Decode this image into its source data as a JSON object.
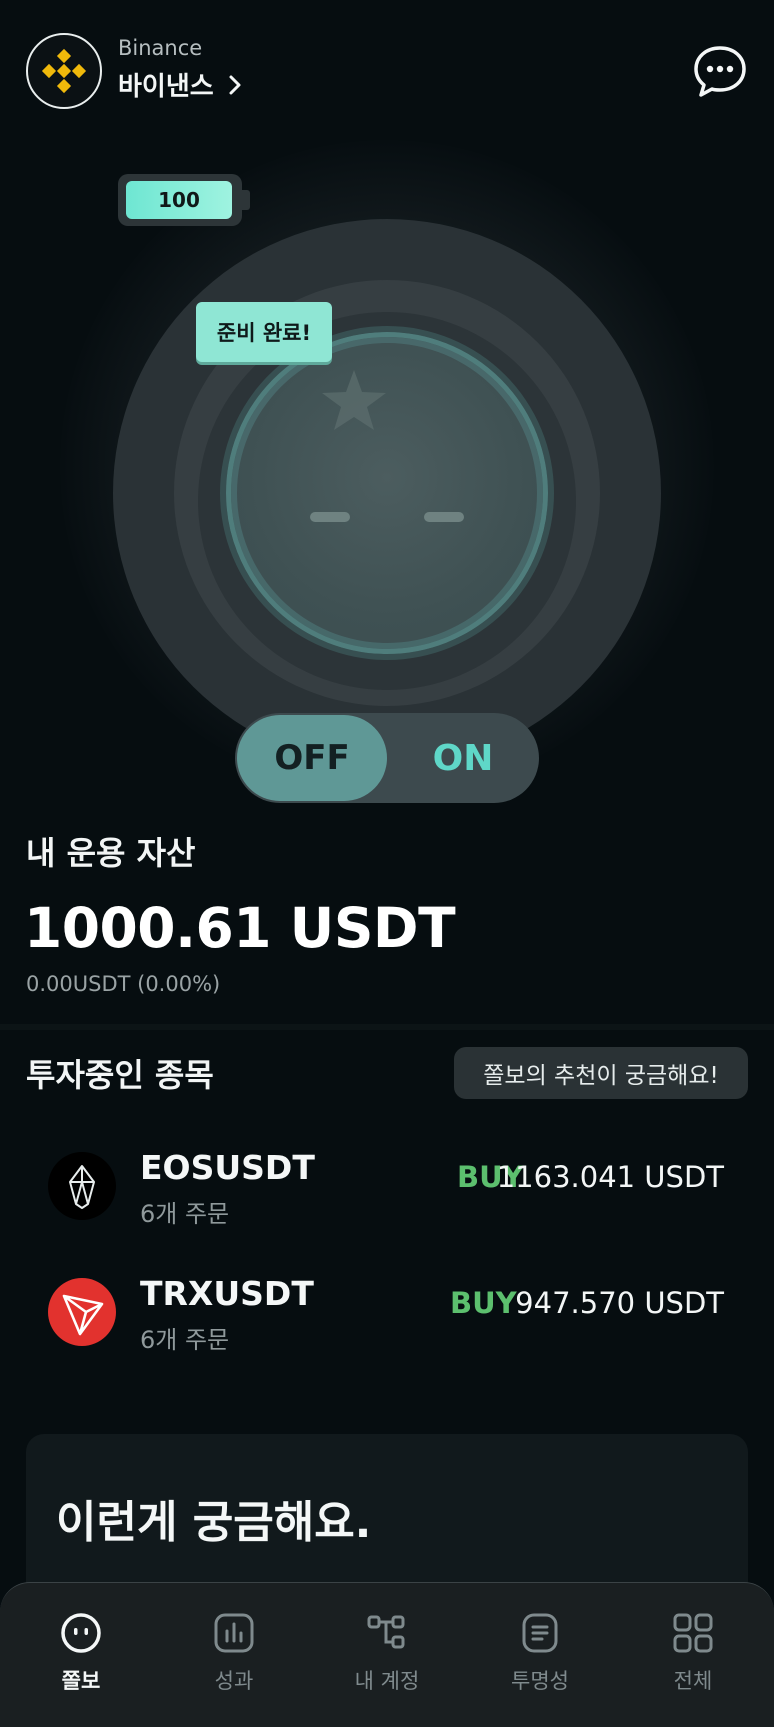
{
  "header": {
    "exchange_en": "Binance",
    "exchange_ko": "바이낸스",
    "chevron": "chevron-right-icon",
    "chat_icon": "chat-bubble-icon"
  },
  "bot": {
    "battery_level": "100",
    "ready_label": "준비 완료!",
    "toggle_off": "OFF",
    "toggle_on": "ON",
    "toggle_state": "OFF"
  },
  "assets": {
    "title": "내 운용 자산",
    "value": "1000.61 USDT",
    "change": "0.00USDT (0.00%)"
  },
  "investments": {
    "title": "투자중인 종목",
    "recommend_button": "쫄보의 추천이 궁금해요!",
    "items": [
      {
        "symbol": "EOSUSDT",
        "orders": "6개 주문",
        "side": "BUY",
        "amount": "1163.041 USDT",
        "icon": "eos-coin-icon"
      },
      {
        "symbol": "TRXUSDT",
        "orders": "6개 주문",
        "side": "BUY",
        "amount": "947.570 USDT",
        "icon": "tron-coin-icon"
      }
    ]
  },
  "faq": {
    "title": "이런게 궁금해요."
  },
  "nav": {
    "items": [
      {
        "label": "쫄보",
        "icon": "bot-face-icon",
        "active": true
      },
      {
        "label": "성과",
        "icon": "bar-chart-icon",
        "active": false
      },
      {
        "label": "내 계정",
        "icon": "account-nodes-icon",
        "active": false
      },
      {
        "label": "투명성",
        "icon": "document-icon",
        "active": false
      },
      {
        "label": "전체",
        "icon": "grid-icon",
        "active": false
      }
    ]
  },
  "colors": {
    "background": "#060d10",
    "accent": "#5fd7c8",
    "buy": "#5cbf6e",
    "binance_yellow": "#f0b90b",
    "tron_red": "#e2322e"
  }
}
